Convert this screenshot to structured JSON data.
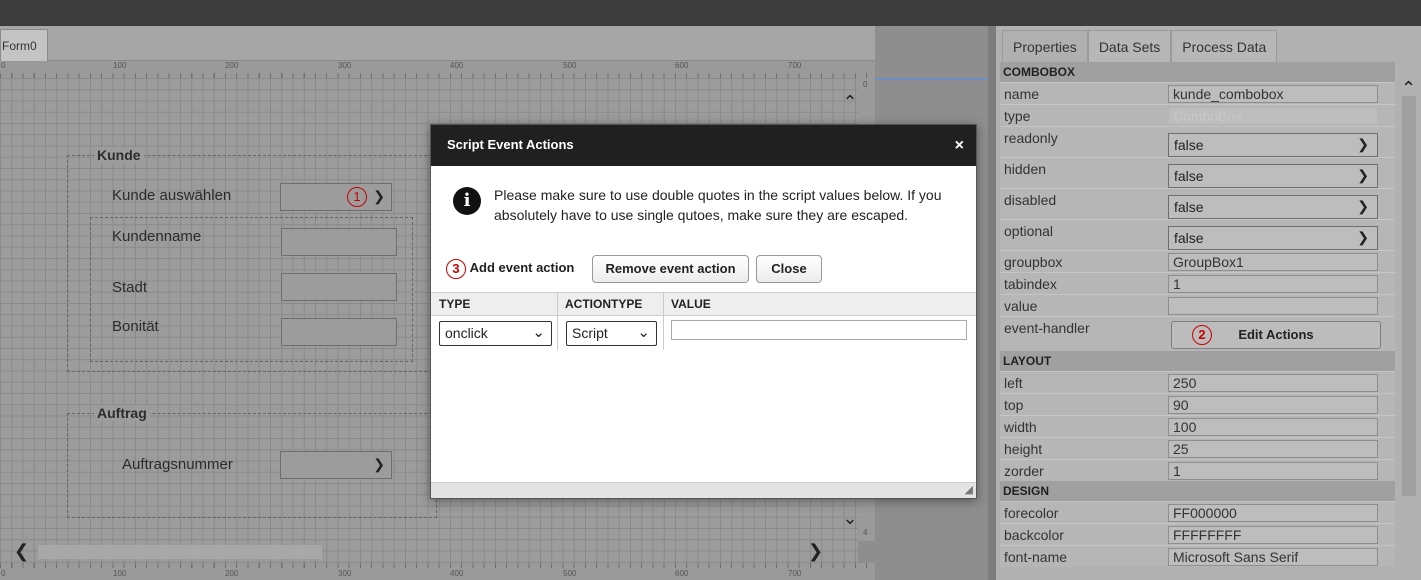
{
  "designer": {
    "form_tab": "Form0",
    "ruler_ticks": [
      "0",
      "100",
      "200",
      "300",
      "400",
      "500",
      "600",
      "700"
    ],
    "ruler_v_top": "0",
    "ruler_v_bottom": [
      "4",
      "0",
      "0"
    ],
    "groupbox_kunde": {
      "title": "Kunde",
      "label_select": "Kunde auswählen",
      "label_name": "Kundenname",
      "label_stadt": "Stadt",
      "label_bonitaet": "Bonität"
    },
    "groupbox_auftrag": {
      "title": "Auftrag",
      "label_nummer": "Auftragsnummer"
    },
    "markers": {
      "one": "1",
      "two": "2",
      "three": "3"
    }
  },
  "dialog": {
    "title": "Script Event Actions",
    "close": "×",
    "message": "Please make sure to use double quotes in the script values below. If you absolutely have to use single qutoes, make sure they are escaped.",
    "buttons": {
      "add": "Add event action",
      "remove": "Remove event action",
      "close": "Close"
    },
    "grid": {
      "columns": [
        "TYPE",
        "ACTIONTYPE",
        "VALUE"
      ],
      "rows": [
        {
          "type": "onclick",
          "actiontype": "Script",
          "value": ""
        }
      ]
    }
  },
  "panel": {
    "tabs": [
      "Properties",
      "Data Sets",
      "Process Data"
    ],
    "sections": {
      "combobox": "COMBOBOX",
      "layout": "LAYOUT",
      "design": "DESIGN"
    },
    "props": {
      "name": {
        "label": "name",
        "value": "kunde_combobox"
      },
      "type": {
        "label": "type",
        "value": "ComboBox"
      },
      "readonly": {
        "label": "readonly",
        "value": "false"
      },
      "hidden": {
        "label": "hidden",
        "value": "false"
      },
      "disabled": {
        "label": "disabled",
        "value": "false"
      },
      "optional": {
        "label": "optional",
        "value": "false"
      },
      "groupbox": {
        "label": "groupbox",
        "value": "GroupBox1"
      },
      "tabindex": {
        "label": "tabindex",
        "value": "1"
      },
      "value": {
        "label": "value",
        "value": ""
      },
      "event_handler": {
        "label": "event-handler",
        "button": "Edit Actions"
      },
      "left": {
        "label": "left",
        "value": "250"
      },
      "top": {
        "label": "top",
        "value": "90"
      },
      "width": {
        "label": "width",
        "value": "100"
      },
      "height": {
        "label": "height",
        "value": "25"
      },
      "zorder": {
        "label": "zorder",
        "value": "1"
      },
      "forecolor": {
        "label": "forecolor",
        "value": "FF000000"
      },
      "backcolor": {
        "label": "backcolor",
        "value": "FFFFFFFF"
      },
      "font_name": {
        "label": "font-name",
        "value": "Microsoft Sans Serif"
      }
    }
  },
  "icons": {
    "chevron_down": "chevron-down-icon",
    "chevron_up": "chevron-up-icon",
    "chevron_left": "chevron-left-icon",
    "chevron_right": "chevron-right-icon",
    "info": "info-icon",
    "close": "close-icon",
    "resize_grip": "resize-grip-icon"
  },
  "colors": {
    "marker": "#cc0000",
    "dialog_header": "#202020"
  }
}
